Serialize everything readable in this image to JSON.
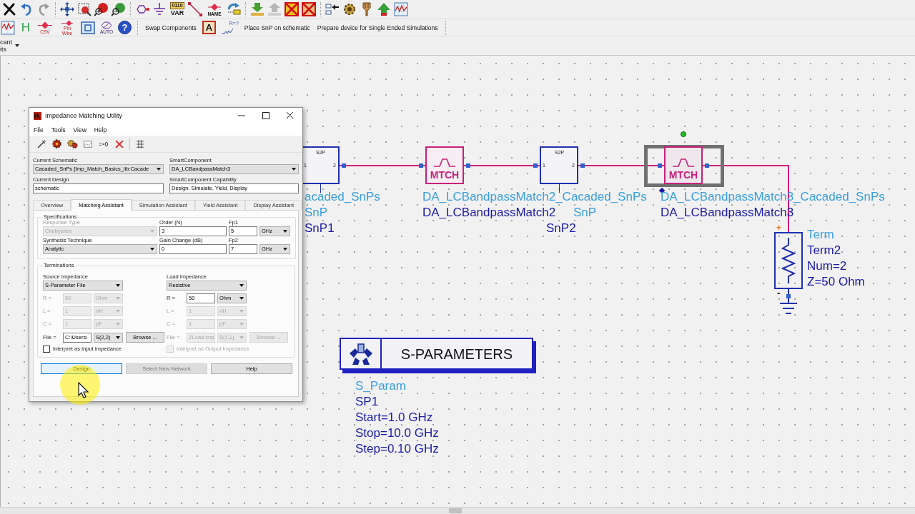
{
  "toolbar": {
    "var_chip": [
      "0110",
      "VAR"
    ],
    "name_chip": "NAME",
    "h_button": "H",
    "csv_chip": "CSV",
    "pin_wire_chip": "Pin Wire",
    "auto_chip": "AUTO",
    "help_button": "?",
    "swap_button": "Swap Components",
    "a_button": "A",
    "r_chip": "R=?",
    "place_snp_button": "Place SnP on schematic",
    "prepare_button": "Prepare device for Single Ended Simulations"
  },
  "layer_selector": {
    "lines": [
      "cant",
      "its"
    ]
  },
  "dialog": {
    "title": "Impedance Matching Utility",
    "menu": [
      "File",
      "Tools",
      "View",
      "Help"
    ],
    "current_schematic": {
      "label": "Current Schematic",
      "value": "Cacaded_SnPs [Imp_Match_Basics_lib:Cacade"
    },
    "smart_component": {
      "label": "SmartComponent",
      "value": "DA_LCBandpassMatch3"
    },
    "current_design": {
      "label": "Current Design",
      "value": "schematic"
    },
    "smart_component_capability": {
      "label": "SmartComponent Capability",
      "value": "Design, Simulate, Yield, Display"
    },
    "tabs": [
      {
        "label": "Overview",
        "selected": false
      },
      {
        "label": "Matching Assistant",
        "selected": true
      },
      {
        "label": "Simulation Assistant",
        "selected": false
      },
      {
        "label": "Yield Assistant",
        "selected": false
      },
      {
        "label": "Display Assistant",
        "selected": false
      }
    ],
    "specifications": {
      "title": "Specifications",
      "response_type": {
        "label": "Response Type",
        "value": "Chebyshev",
        "disabled": true
      },
      "order": {
        "label": "Order (N)",
        "value": "3"
      },
      "fp1": {
        "label": "Fp1",
        "value": "5",
        "unit": "GHz"
      },
      "synthesis_technique": {
        "label": "Synthesis Technique",
        "value": "Analytic",
        "disabled": false
      },
      "gain_change": {
        "label": "Gain Change (dB)",
        "value": "0"
      },
      "fp2": {
        "label": "Fp2",
        "value": "7",
        "unit": "GHz"
      }
    },
    "terminations": {
      "title": "Terminations",
      "source": {
        "label": "Source Impedance",
        "type": "S-Parameter File",
        "rows": [
          {
            "label": "R =",
            "value": "50",
            "unit": "Ohm",
            "disabled": true
          },
          {
            "label": "L =",
            "value": "1",
            "unit": "nH",
            "disabled": true
          },
          {
            "label": "C =",
            "value": "1",
            "unit": "pF",
            "disabled": true
          }
        ],
        "file": {
          "label": "File =",
          "value": "C:\\Users\\",
          "param": "S(2,2)",
          "browse": "Browse ...",
          "disabled": false
        },
        "interpret": {
          "label": "Interpret as Input Impedance",
          "checked": false,
          "disabled": false
        }
      },
      "load": {
        "label": "Load Impedance",
        "type": "Resistive",
        "rows": [
          {
            "label": "R =",
            "value": "50",
            "unit": "Ohm",
            "disabled": false
          },
          {
            "label": "L =",
            "value": "1",
            "unit": "nH",
            "disabled": true
          },
          {
            "label": "C =",
            "value": "1",
            "unit": "pF",
            "disabled": true
          }
        ],
        "file": {
          "label": "File =",
          "value": "ZLoad.snp",
          "param": "S(1,1)",
          "browse": "Browse ...",
          "disabled": true
        },
        "interpret": {
          "label": "Interpret as Output Impedance",
          "checked": false,
          "disabled": true
        }
      }
    },
    "buttons": [
      {
        "label": "Design",
        "disabled": false,
        "focused": true
      },
      {
        "label": "Select New Network",
        "disabled": true,
        "focused": false
      },
      {
        "label": "Help",
        "disabled": false,
        "focused": false
      }
    ]
  },
  "schematic": {
    "components": [
      {
        "kind": "snp",
        "symbol": "S2P",
        "pins": [
          "1",
          "2"
        ],
        "type_labels": [
          "acaded_SnPs",
          "SnP"
        ],
        "labels": [
          "SnP1"
        ]
      },
      {
        "kind": "match",
        "symbol": "MTCH",
        "type_labels": [
          "DA_LCBandpassMatch2_Cacaded_SnPs"
        ],
        "labels": [
          "DA_LCBandpassMatch2"
        ],
        "selected": false
      },
      {
        "kind": "snp",
        "symbol": "S2P",
        "pins": [
          "1",
          "2"
        ],
        "type_labels": [
          "SnP"
        ],
        "labels": [
          "SnP2"
        ]
      },
      {
        "kind": "match",
        "symbol": "MTCH",
        "type_labels": [
          "DA_LCBandpassMatch3_Cacaded_SnPs"
        ],
        "labels": [
          "DA_LCBandpassMatch3"
        ],
        "selected": true
      },
      {
        "kind": "term",
        "polarity": [
          "+",
          "-"
        ],
        "type_labels": [
          "Term"
        ],
        "labels": [
          "Term2",
          "Num=2",
          "Z=50 Ohm"
        ]
      },
      {
        "kind": "sparam",
        "title": "S-PARAMETERS",
        "type_labels": [
          "S_Param"
        ],
        "labels": [
          "SP1",
          "Start=1.0 GHz",
          "Stop=10.0 GHz",
          "Step=0.10 GHz"
        ]
      }
    ]
  }
}
